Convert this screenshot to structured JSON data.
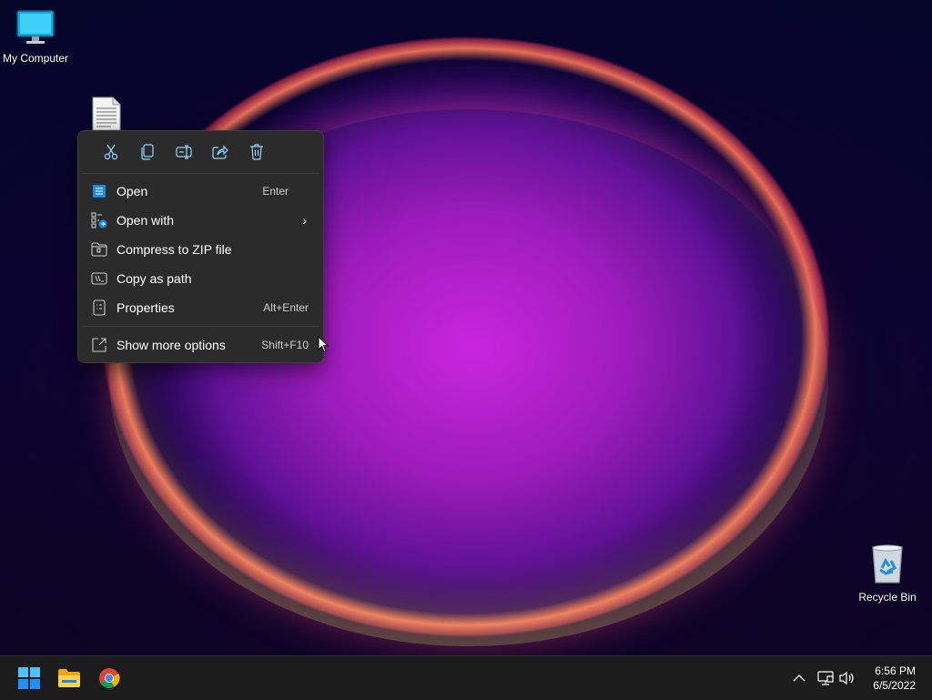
{
  "desktop": {
    "icons": [
      {
        "label": "My Computer",
        "icon": "monitor-icon"
      },
      {
        "label": "",
        "icon": "text-file-icon"
      },
      {
        "label": "Recycle Bin",
        "icon": "recycle-bin-icon"
      }
    ]
  },
  "context_menu": {
    "quick_actions": [
      {
        "name": "cut",
        "icon": "scissors-icon"
      },
      {
        "name": "copy",
        "icon": "copy-icon"
      },
      {
        "name": "rename",
        "icon": "rename-icon"
      },
      {
        "name": "share",
        "icon": "share-icon"
      },
      {
        "name": "delete",
        "icon": "trash-icon"
      }
    ],
    "items": [
      {
        "label": "Open",
        "shortcut": "Enter",
        "icon": "notepad-icon"
      },
      {
        "label": "Open with",
        "shortcut": "",
        "icon": "open-with-icon",
        "submenu": true
      },
      {
        "label": "Compress to ZIP file",
        "shortcut": "",
        "icon": "zip-folder-icon"
      },
      {
        "label": "Copy as path",
        "shortcut": "",
        "icon": "copy-path-icon"
      },
      {
        "label": "Properties",
        "shortcut": "Alt+Enter",
        "icon": "properties-icon"
      },
      {
        "label": "Show more options",
        "shortcut": "Shift+F10",
        "icon": "more-options-icon"
      }
    ]
  },
  "taskbar": {
    "apps": [
      {
        "name": "start",
        "icon": "windows-logo-icon"
      },
      {
        "name": "file-explorer",
        "icon": "folder-icon"
      },
      {
        "name": "chrome",
        "icon": "chrome-icon"
      }
    ],
    "tray": {
      "icons": [
        "chevron-up-icon",
        "network-icon",
        "volume-icon"
      ]
    },
    "clock": {
      "time": "6:56 PM",
      "date": "6/5/2022"
    }
  },
  "colors": {
    "menu_bg": "#2b2b2b",
    "taskbar_bg": "#1c1c1c",
    "accent": "#60cdff"
  }
}
